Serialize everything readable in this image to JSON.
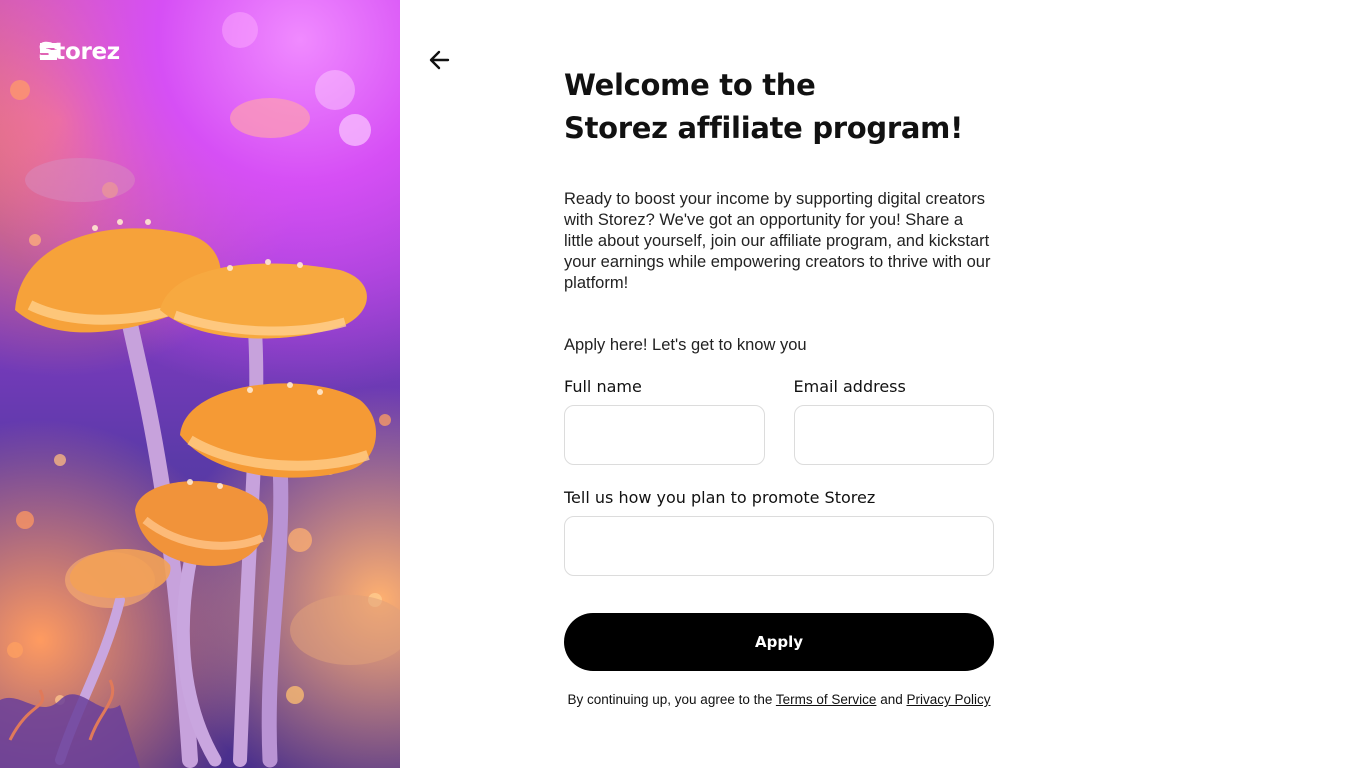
{
  "brand": {
    "name": "Storez"
  },
  "hero": {
    "image": "glowing mushrooms illustration"
  },
  "nav": {
    "back_icon": "arrow-left-icon"
  },
  "header": {
    "title_line1": "Welcome to the",
    "title_line2": "Storez affiliate program!"
  },
  "intro": "Ready to boost your income by supporting digital creators with Storez? We've got an opportunity for you! Share a little about yourself, join our affiliate program, and kickstart your earnings while empowering creators to thrive with our platform!",
  "form": {
    "subhead": "Apply here! Let's get to know you",
    "full_name": {
      "label": "Full name",
      "value": "",
      "placeholder": ""
    },
    "email": {
      "label": "Email address",
      "value": "",
      "placeholder": ""
    },
    "promote": {
      "label": "Tell us how you plan to promote Storez",
      "value": "",
      "placeholder": ""
    },
    "apply_label": "Apply"
  },
  "legal": {
    "prefix": "By continuing up, you agree to the",
    "terms": "Terms of Service",
    "and": "and",
    "privacy": "Privacy Policy"
  },
  "colors": {
    "accent": "#000000",
    "background": "#ffffff",
    "border": "#dcdcdc"
  }
}
